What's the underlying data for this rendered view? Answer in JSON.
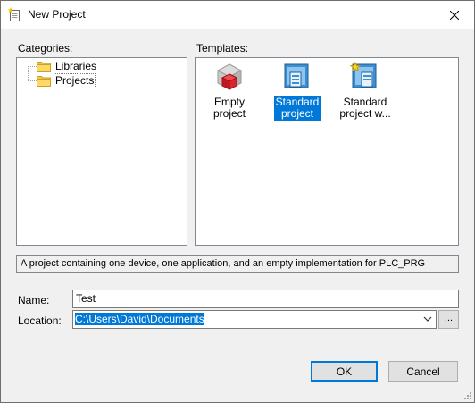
{
  "window": {
    "title": "New Project"
  },
  "icons": {
    "app": "new-project-icon",
    "close": "close-icon",
    "folder": "folder-icon",
    "dropdown": "chevron-down-icon"
  },
  "categories": {
    "label": "Categories:",
    "items": [
      {
        "label": "Libraries"
      },
      {
        "label": "Projects"
      }
    ]
  },
  "templates": {
    "label": "Templates:",
    "items": [
      {
        "line1": "Empty project",
        "line2": "",
        "icon": "empty-project-icon"
      },
      {
        "line1": "Standard",
        "line2": "project",
        "icon": "standard-project-icon",
        "selected": true
      },
      {
        "line1": "Standard",
        "line2": "project w...",
        "icon": "standard-project-wizard-icon"
      }
    ]
  },
  "description": "A project containing one device, one application, and an empty implementation for PLC_PRG",
  "name": {
    "label": "Name:",
    "value": "Test"
  },
  "location": {
    "label": "Location:",
    "value": "C:\\Users\\David\\Documents",
    "browse_label": "..."
  },
  "buttons": {
    "ok": "OK",
    "cancel": "Cancel"
  },
  "colors": {
    "selection": "#0078d7",
    "folder": "#f5c542",
    "brick_red": "#d9262b"
  }
}
